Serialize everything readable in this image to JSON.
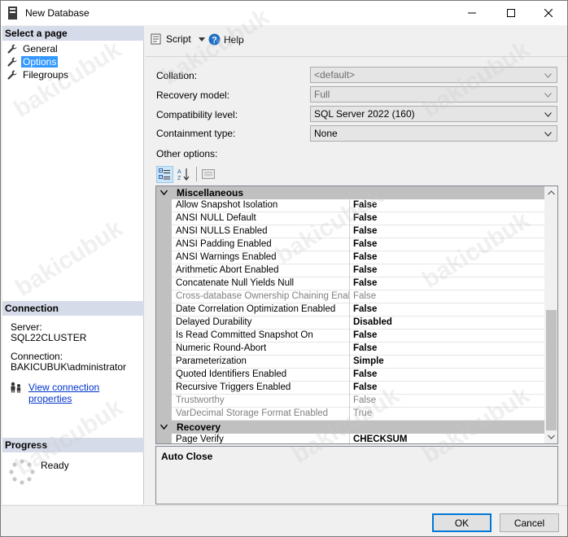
{
  "window": {
    "title": "New Database"
  },
  "sidebar": {
    "select_page_heading": "Select a page",
    "pages": [
      {
        "label": "General",
        "selected": false
      },
      {
        "label": "Options",
        "selected": true
      },
      {
        "label": "Filegroups",
        "selected": false
      }
    ],
    "connection": {
      "heading": "Connection",
      "server_label": "Server:",
      "server_value": "SQL22CLUSTER",
      "connection_label": "Connection:",
      "connection_value": "BAKICUBUK\\administrator",
      "link": "View connection properties"
    },
    "progress": {
      "heading": "Progress",
      "status": "Ready"
    }
  },
  "toolbar": {
    "script_label": "Script",
    "help_label": "Help"
  },
  "form": {
    "collation": {
      "label": "Collation:",
      "value": "<default>",
      "enabled": false
    },
    "recovery_model": {
      "label": "Recovery model:",
      "value": "Full",
      "enabled": false
    },
    "compatibility_level": {
      "label": "Compatibility level:",
      "value": "SQL Server 2022 (160)",
      "enabled": true
    },
    "containment_type": {
      "label": "Containment type:",
      "value": "None",
      "enabled": true
    },
    "other_options_label": "Other options:"
  },
  "property_grid": {
    "categories": [
      {
        "name": "Miscellaneous",
        "rows": [
          {
            "name": "Allow Snapshot Isolation",
            "value": "False",
            "readonly": false
          },
          {
            "name": "ANSI NULL Default",
            "value": "False",
            "readonly": false
          },
          {
            "name": "ANSI NULLS Enabled",
            "value": "False",
            "readonly": false
          },
          {
            "name": "ANSI Padding Enabled",
            "value": "False",
            "readonly": false
          },
          {
            "name": "ANSI Warnings Enabled",
            "value": "False",
            "readonly": false
          },
          {
            "name": "Arithmetic Abort Enabled",
            "value": "False",
            "readonly": false
          },
          {
            "name": "Concatenate Null Yields Null",
            "value": "False",
            "readonly": false
          },
          {
            "name": "Cross-database Ownership Chaining Enabled",
            "value": "False",
            "readonly": true
          },
          {
            "name": "Date Correlation Optimization Enabled",
            "value": "False",
            "readonly": false
          },
          {
            "name": "Delayed Durability",
            "value": "Disabled",
            "readonly": false
          },
          {
            "name": "Is Read Committed Snapshot On",
            "value": "False",
            "readonly": false
          },
          {
            "name": "Numeric Round-Abort",
            "value": "False",
            "readonly": false
          },
          {
            "name": "Parameterization",
            "value": "Simple",
            "readonly": false
          },
          {
            "name": "Quoted Identifiers Enabled",
            "value": "False",
            "readonly": false
          },
          {
            "name": "Recursive Triggers Enabled",
            "value": "False",
            "readonly": false
          },
          {
            "name": "Trustworthy",
            "value": "False",
            "readonly": true
          },
          {
            "name": "VarDecimal Storage Format Enabled",
            "value": "True",
            "readonly": true
          }
        ]
      },
      {
        "name": "Recovery",
        "rows": [
          {
            "name": "Page Verify",
            "value": "CHECKSUM",
            "readonly": false
          }
        ]
      }
    ],
    "description_title": "Auto Close"
  },
  "buttons": {
    "ok": "OK",
    "cancel": "Cancel"
  },
  "watermark_text": "bakicubuk"
}
